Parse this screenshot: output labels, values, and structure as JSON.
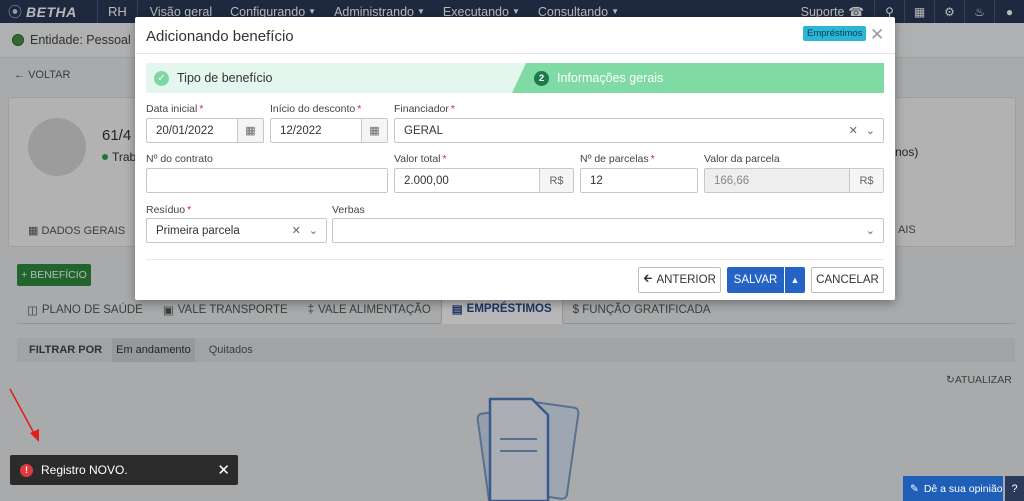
{
  "nav": {
    "brand": "BETHA",
    "app": "RH",
    "menu": [
      "Visão geral",
      "Configurando",
      "Administrando",
      "Executando",
      "Consultando"
    ],
    "suporte": "Suporte"
  },
  "background": {
    "entity": "Entidade: Pessoal - T",
    "voltar": "VOLTAR",
    "profile_name": "61/4",
    "profile_status": "Trab",
    "profile_extra": "nos)",
    "tab_dados_gerais": "DADOS GERAIS",
    "tab_right_fragment": "AIS",
    "add_beneficio": "+ BENEFÍCIO",
    "subtabs": [
      "PLANO DE SAÚDE",
      "VALE TRANSPORTE",
      "VALE ALIMENTAÇÃO",
      "EMPRÉSTIMOS",
      "$ FUNÇÃO GRATIFICADA"
    ],
    "filter_label": "FILTRAR POR",
    "filters": [
      "Em andamento",
      "Quitados"
    ],
    "atualizar": "ATUALIZAR"
  },
  "toast": {
    "message": "Registro NOVO."
  },
  "feedback": {
    "label": "Dê a sua opinião",
    "help": "?"
  },
  "modal": {
    "title": "Adicionando benefício",
    "badge": "Empréstimos",
    "step1_label": "Tipo de benefício",
    "step2_number": "2",
    "step2_label": "Informações gerais",
    "fields": {
      "data_inicial": {
        "label": "Data inicial",
        "value": "20/01/2022"
      },
      "inicio_desconto": {
        "label": "Início do desconto",
        "value": "12/2022"
      },
      "financiador": {
        "label": "Financiador",
        "value": "GERAL"
      },
      "num_contrato": {
        "label": "Nº do contrato",
        "value": ""
      },
      "valor_total": {
        "label": "Valor total",
        "value": "2.000,00",
        "addon": "R$"
      },
      "num_parcelas": {
        "label": "Nº de parcelas",
        "value": "12"
      },
      "valor_parcela": {
        "label": "Valor da parcela",
        "value": "166,66",
        "addon": "R$"
      },
      "residuo": {
        "label": "Resíduo",
        "value": "Primeira parcela"
      },
      "verbas": {
        "label": "Verbas",
        "value": ""
      }
    },
    "buttons": {
      "anterior": "ANTERIOR",
      "salvar": "SALVAR",
      "cancelar": "CANCELAR"
    }
  },
  "colors": {
    "nav_bg": "#2a3a58",
    "primary": "#2563c4",
    "step_active": "#7fdba3",
    "success": "#2e8b3d",
    "required": "#d9262c"
  }
}
